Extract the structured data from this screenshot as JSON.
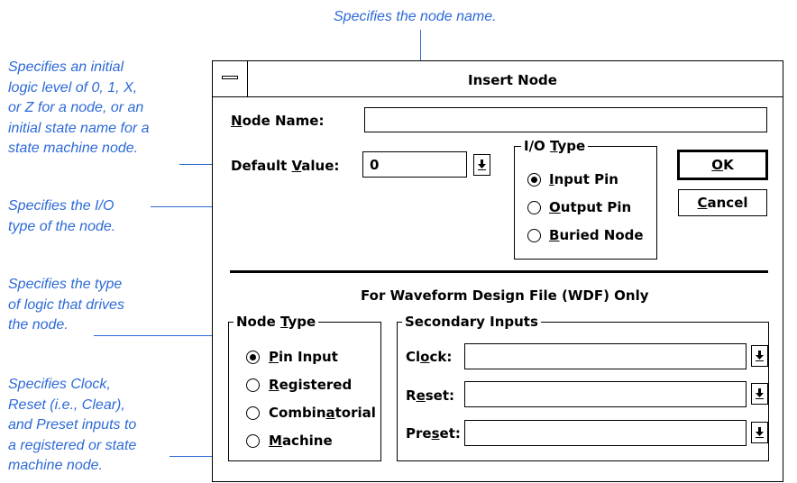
{
  "annotations": {
    "node_name": "Specifies the node name.",
    "default_value": [
      "Specifies an initial",
      "logic level of 0, 1, X,",
      "or Z for a node, or an",
      "initial state name for a",
      "state machine node."
    ],
    "io_type": [
      "Specifies the I/O",
      "type of the node."
    ],
    "node_type": [
      "Specifies the type",
      "of logic that drives",
      "the node."
    ],
    "secondary_inputs": [
      "Specifies Clock,",
      "Reset (i.e., Clear),",
      "and Preset inputs to",
      "a registered or state",
      "machine node."
    ]
  },
  "dialog": {
    "title": "Insert Node",
    "system_menu_icon": "dash-icon",
    "node_name": {
      "label_u": "N",
      "label_rest": "ode Name:",
      "value": ""
    },
    "default_value": {
      "label_pre": "Default ",
      "label_u": "V",
      "label_rest": "alue:",
      "value": "0"
    },
    "io_type": {
      "title_pre": "I/O ",
      "title_u": "T",
      "title_rest": "ype",
      "options": [
        {
          "u": "I",
          "rest": "nput Pin",
          "selected": true
        },
        {
          "u": "O",
          "rest": "utput Pin",
          "selected": false
        },
        {
          "u": "B",
          "rest": "uried Node",
          "selected": false
        }
      ]
    },
    "ok": {
      "u": "O",
      "rest": "K"
    },
    "cancel": {
      "u": "C",
      "rest": "ancel"
    },
    "wdf_heading": "For Waveform Design File (WDF) Only",
    "node_type": {
      "title_pre": "Node ",
      "title_u": "T",
      "title_rest": "ype",
      "options": [
        {
          "pre": "",
          "u": "P",
          "rest": "in Input",
          "selected": true
        },
        {
          "pre": "",
          "u": "R",
          "rest": "egistered",
          "selected": false
        },
        {
          "pre": "Combin",
          "u": "a",
          "rest": "torial",
          "selected": false
        },
        {
          "pre": "",
          "u": "M",
          "rest": "achine",
          "selected": false
        }
      ]
    },
    "secondary_inputs": {
      "title": "Secondary Inputs",
      "fields": [
        {
          "pre": "Cl",
          "u": "o",
          "rest": "ck:",
          "value": ""
        },
        {
          "pre": "R",
          "u": "e",
          "rest": "set:",
          "value": ""
        },
        {
          "pre": "Pre",
          "u": "s",
          "rest": "et:",
          "value": ""
        }
      ]
    }
  }
}
